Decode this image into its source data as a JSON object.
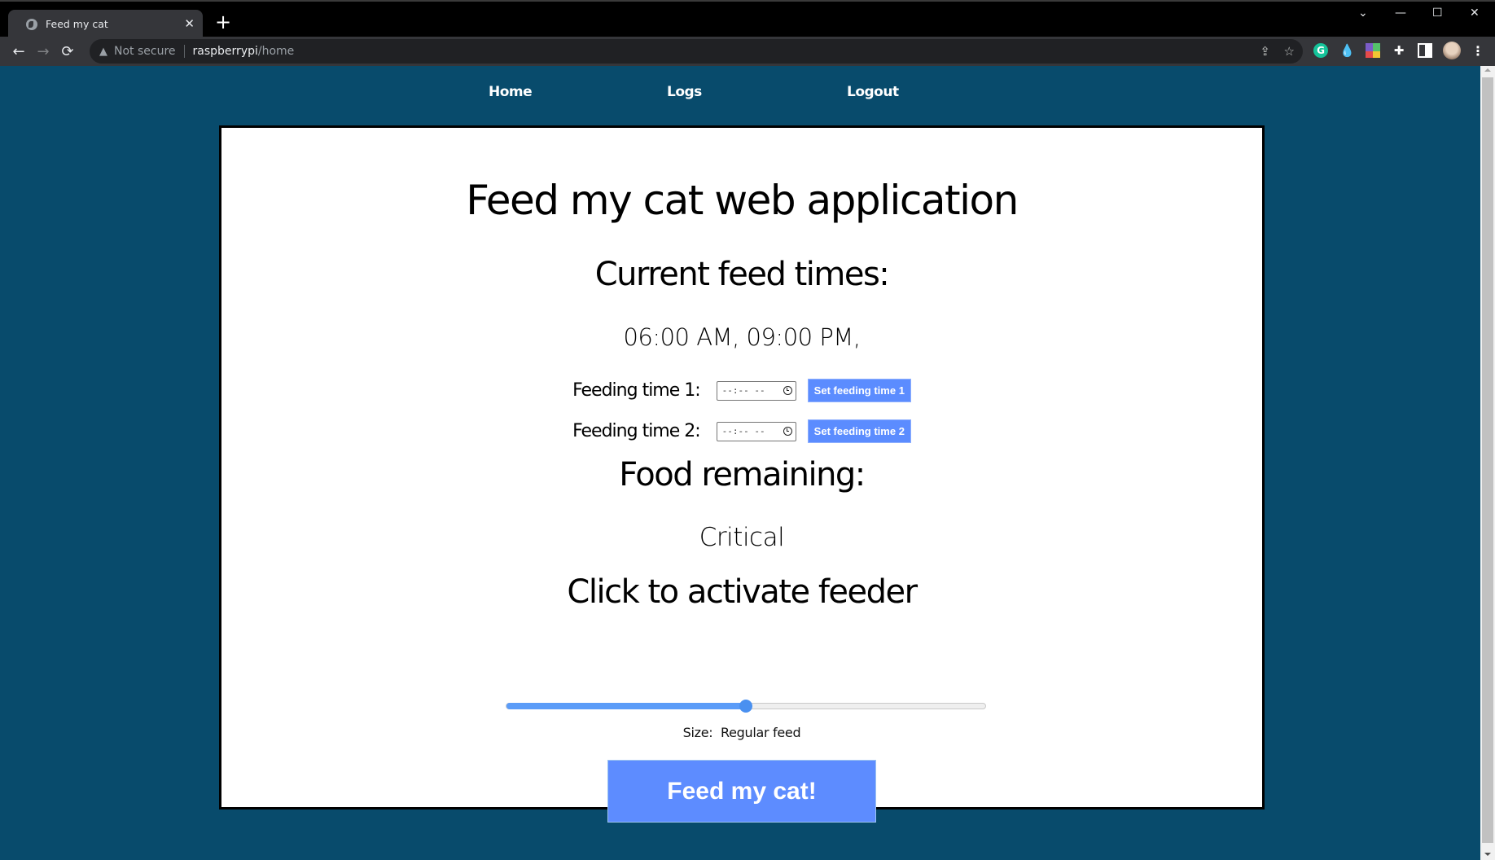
{
  "browser": {
    "tab_title": "Feed my cat",
    "new_tab_label": "+",
    "tab_close_label": "✕",
    "security_label": "Not secure",
    "url_host": "raspberrypi",
    "url_path": "/home",
    "window_controls": {
      "tab_search": "⌄",
      "minimize": "—",
      "maximize": "☐",
      "close": "✕"
    },
    "nav": {
      "back": "←",
      "forward": "→",
      "reload": "⟳"
    },
    "extensions": [
      "grammarly-icon",
      "drop-icon",
      "color-grid-icon",
      "puzzle-icon",
      "side-panel-icon",
      "profile-avatar",
      "menu-icon"
    ]
  },
  "nav": {
    "items": [
      {
        "label": "Home"
      },
      {
        "label": "Logs"
      },
      {
        "label": "Logout"
      }
    ]
  },
  "main": {
    "title": "Feed my cat web application",
    "current_times_heading": "Current feed times:",
    "current_times": "06:00 AM, 09:00 PM,",
    "feeding_rows": [
      {
        "label": "Feeding time 1:",
        "input_value": "--:-- --",
        "button": "Set feeding time 1"
      },
      {
        "label": "Feeding time 2:",
        "input_value": "--:-- --",
        "button": "Set feeding time 2"
      }
    ],
    "food_heading": "Food remaining:",
    "food_status": "Critical",
    "activate_heading": "Click to activate feeder",
    "feed_size_slider": {
      "value_fraction": 0.5
    },
    "size_label": "Size:",
    "size_value": "Regular feed",
    "feed_button": "Feed my cat!"
  },
  "colors": {
    "page_background": "#084b6c",
    "button_blue": "#5d8cff",
    "slider_blue": "#4a90f0"
  }
}
